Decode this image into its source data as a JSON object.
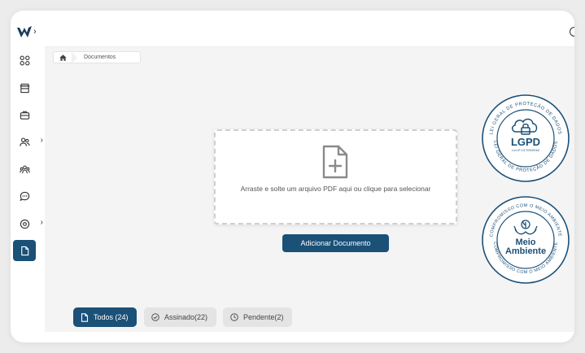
{
  "breadcrumb": {
    "current": "Documentos"
  },
  "sidebar": {
    "items": [
      {
        "name": "dashboard",
        "icon": "grid-icon",
        "has_sub": false
      },
      {
        "name": "store",
        "icon": "store-icon",
        "has_sub": false
      },
      {
        "name": "briefcase",
        "icon": "briefcase-icon",
        "has_sub": false
      },
      {
        "name": "users",
        "icon": "users-icon",
        "has_sub": true
      },
      {
        "name": "team",
        "icon": "team-icon",
        "has_sub": false
      },
      {
        "name": "chat",
        "icon": "chat-bubble-icon",
        "has_sub": false
      },
      {
        "name": "settings",
        "icon": "settings-icon",
        "has_sub": true
      },
      {
        "name": "documents",
        "icon": "document-icon",
        "has_sub": false,
        "active": true
      }
    ]
  },
  "upload": {
    "dropzone_text": "Arraste e solte um arquivo PDF aqui ou clique para selecionar",
    "add_button": "Adicionar Documento"
  },
  "filters": {
    "all": "Todos (24)",
    "signed": "Assinado(22)",
    "pending": "Pendente(2)"
  },
  "seals": {
    "lgpd": {
      "title": "LGPD",
      "subtitle": "Lei nº 13.709/2018",
      "ring_top": "LEI GERAL DE PROTEÇÃO DE DADOS",
      "ring_bottom": "LEI GERAL DE PROTEÇÃO DE DADOS"
    },
    "meio": {
      "title_line1": "Meio",
      "title_line2": "Ambiente",
      "ring_top": "COMPROMISSO COM O MEIO AMBIENTE",
      "ring_bottom": "COMPROMISSO COM O MEIO AMBIENTE"
    }
  },
  "colors": {
    "primary": "#1b5077",
    "seal": "#1b5077"
  }
}
